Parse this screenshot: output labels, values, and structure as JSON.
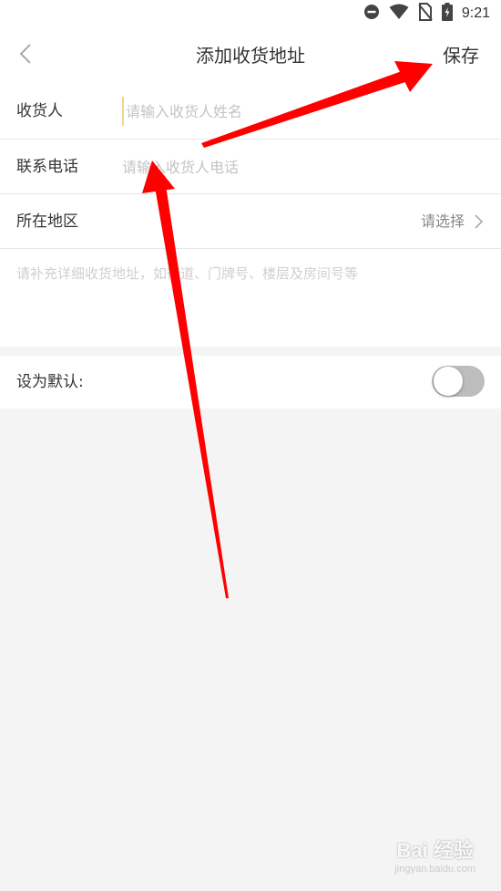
{
  "status_bar": {
    "time": "9:21",
    "icons": [
      "do-not-disturb-icon",
      "wifi-icon",
      "no-sim-icon",
      "battery-charging-icon"
    ]
  },
  "header": {
    "back_icon": "chevron-left-icon",
    "title": "添加收货地址",
    "save_label": "保存"
  },
  "form": {
    "recipient": {
      "label": "收货人",
      "placeholder": "请输入收货人姓名",
      "value": ""
    },
    "phone": {
      "label": "联系电话",
      "placeholder": "请输入收货人电话",
      "value": ""
    },
    "region": {
      "label": "所在地区",
      "value": "请选择",
      "icon": "chevron-right-icon"
    },
    "detail": {
      "placeholder": "请补充详细收货地址，如街道、门牌号、楼层及房间号等",
      "value": ""
    }
  },
  "default_setting": {
    "label": "设为默认:",
    "enabled": false
  },
  "colors": {
    "annotation_arrow": "#ff0000",
    "cursor": "#f2d58a",
    "toggle_off": "#bdbdbd",
    "background": "#f4f4f4"
  },
  "watermark": {
    "main": "Bai 经验",
    "sub": "jingyan.baidu.com"
  }
}
